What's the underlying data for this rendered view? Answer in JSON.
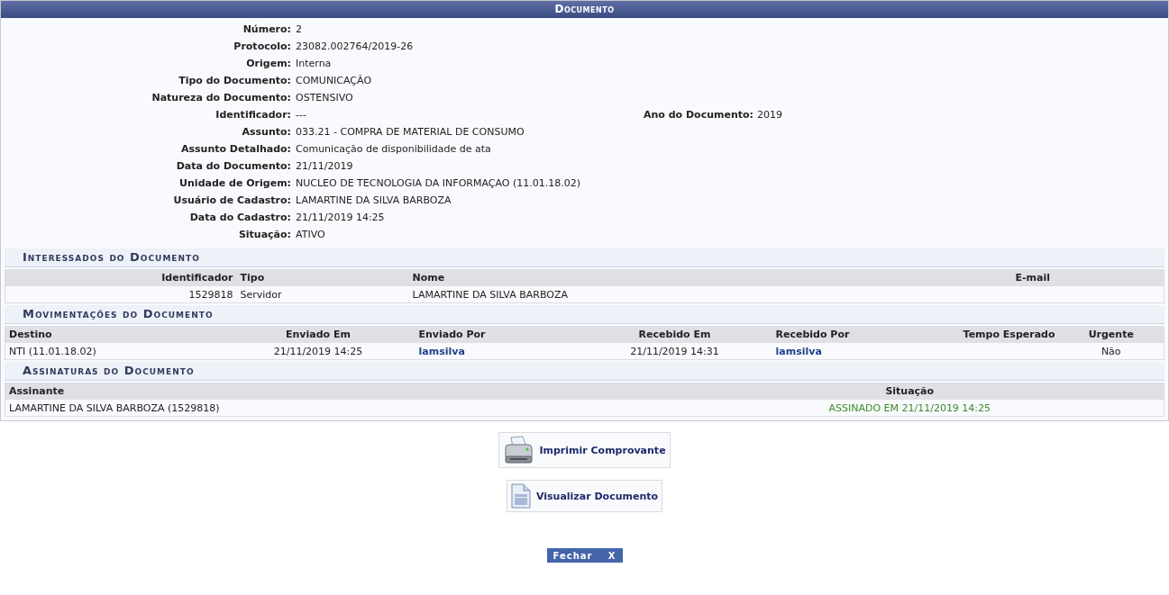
{
  "window": {
    "title": "Documento"
  },
  "fields": [
    {
      "label": "Número:",
      "value": "2"
    },
    {
      "label": "Protocolo:",
      "value": "23082.002764/2019-26"
    },
    {
      "label": "Origem:",
      "value": "Interna"
    },
    {
      "label": "Tipo do Documento:",
      "value": "COMUNICAÇÃO"
    },
    {
      "label": "Natureza do Documento:",
      "value": "OSTENSIVO"
    },
    {
      "label": "Identificador:",
      "value": "---",
      "side": {
        "label": "Ano do Documento:",
        "value": "2019"
      }
    },
    {
      "label": "Assunto:",
      "value": "033.21 - COMPRA DE MATERIAL DE CONSUMO"
    },
    {
      "label": "Assunto Detalhado:",
      "value": "Comunicação de disponibilidade de ata"
    },
    {
      "label": "Data do Documento:",
      "value": "21/11/2019"
    },
    {
      "label": "Unidade de Origem:",
      "value": "NUCLEO DE TECNOLOGIA DA INFORMAÇAO (11.01.18.02)"
    },
    {
      "label": "Usuário de Cadastro:",
      "value": "LAMARTINE DA SILVA BARBOZA"
    },
    {
      "label": "Data do Cadastro:",
      "value": "21/11/2019 14:25"
    },
    {
      "label": "Situação:",
      "value": "ATIVO"
    }
  ],
  "sections": [
    {
      "title": "Interessados do Documento",
      "columns": [
        "Identificador",
        "Tipo",
        "Nome",
        "E-mail"
      ],
      "rows": [
        [
          {
            "kind": "text",
            "text": "1529818"
          },
          {
            "kind": "text",
            "text": "Servidor"
          },
          {
            "kind": "text",
            "text": "LAMARTINE DA SILVA BARBOZA"
          },
          {
            "kind": "empty"
          }
        ]
      ]
    },
    {
      "title": "Movimentações do Documento",
      "columns": [
        "Destino",
        "Enviado Em",
        "Enviado Por",
        "Recebido Em",
        "Recebido Por",
        "Tempo Esperado",
        "Urgente"
      ],
      "rows": [
        [
          {
            "kind": "text",
            "text": "NTI (11.01.18.02)"
          },
          {
            "kind": "text",
            "text": "21/11/2019 14:25"
          },
          {
            "kind": "link",
            "text": "lamsilva"
          },
          {
            "kind": "text",
            "text": "21/11/2019 14:31"
          },
          {
            "kind": "link",
            "text": "lamsilva"
          },
          {
            "kind": "empty"
          },
          {
            "kind": "text",
            "text": "Não"
          }
        ]
      ]
    },
    {
      "title": "Assinaturas do Documento",
      "columns": [
        "Assinante",
        "Situação"
      ],
      "rows": [
        [
          {
            "kind": "text",
            "text": "LAMARTINE DA SILVA BARBOZA (1529818)"
          },
          {
            "kind": "status",
            "text": "ASSINADO EM 21/11/2019 14:25"
          }
        ]
      ]
    }
  ],
  "actions": [
    {
      "kind": "print",
      "label": "Imprimir Comprovante"
    },
    {
      "kind": "view",
      "label": "Visualizar Documento"
    }
  ],
  "close": {
    "label": "Fechar",
    "icon": "X"
  }
}
